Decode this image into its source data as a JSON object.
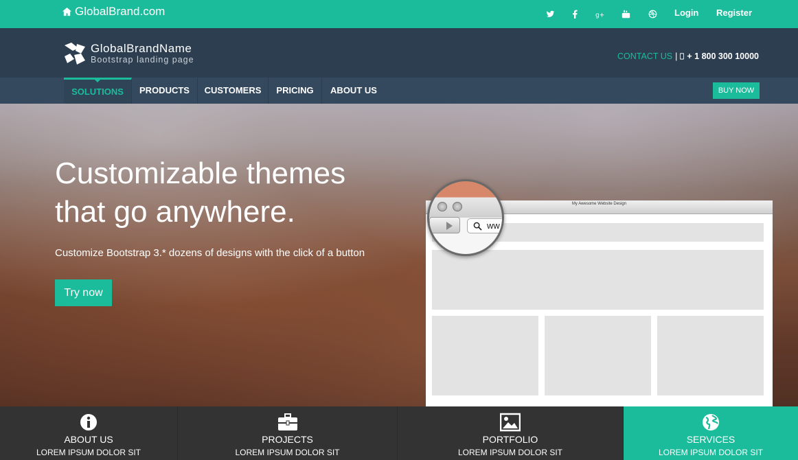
{
  "topbar": {
    "site_name": "GlobalBrand.com",
    "social_icons": [
      "twitter-icon",
      "facebook-icon",
      "google-plus-icon",
      "youtube-icon",
      "dribbble-icon"
    ],
    "login_label": "Login",
    "register_label": "Register"
  },
  "header": {
    "brand_name": "GlobalBrandName",
    "brand_tagline": "Bootstrap landing page",
    "contact_label": "CONTACT US",
    "contact_separator": "|",
    "phone": "+ 1 800 300 10000"
  },
  "nav": {
    "items": [
      {
        "label": "SOLUTIONS",
        "active": true
      },
      {
        "label": "PRODUCTS",
        "active": false
      },
      {
        "label": "CUSTOMERS",
        "active": false
      },
      {
        "label": "PRICING",
        "active": false
      },
      {
        "label": "ABOUT US",
        "active": false
      }
    ],
    "buy_label": "BUY NOW"
  },
  "hero": {
    "heading_line1": "Customizable themes",
    "heading_line2": "that go anywhere.",
    "subtext": "Customize Bootstrap 3.* dozens of designs with the click of a button",
    "cta_label": "Try now",
    "mockup_title": "My Awesome Website Design",
    "mockup_url_text": "ww"
  },
  "features": [
    {
      "icon": "info-icon",
      "title": "ABOUT US",
      "subtitle": "LOREM IPSUM DOLOR SIT",
      "active": false
    },
    {
      "icon": "briefcase-icon",
      "title": "PROJECTS",
      "subtitle": "LOREM IPSUM DOLOR SIT",
      "active": false
    },
    {
      "icon": "picture-icon",
      "title": "PORTFOLIO",
      "subtitle": "LOREM IPSUM DOLOR SIT",
      "active": false
    },
    {
      "icon": "globe-icon",
      "title": "SERVICES",
      "subtitle": "LOREM IPSUM DOLOR SIT",
      "active": true
    }
  ],
  "colors": {
    "accent": "#1bbc9b",
    "header_bg": "#2c3e50",
    "nav_bg": "#34495e",
    "feature_bg": "#333333"
  }
}
